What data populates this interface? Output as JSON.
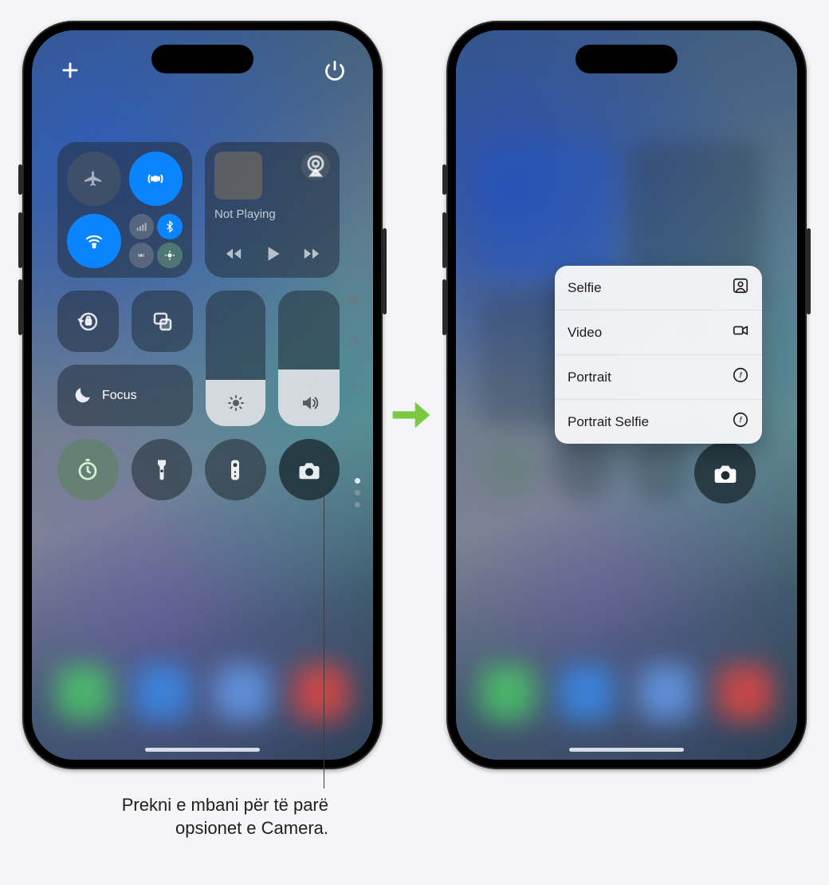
{
  "control_center": {
    "music": {
      "status": "Not Playing"
    },
    "focus": {
      "label": "Focus"
    },
    "sliders": {
      "brightness_pct": 34,
      "volume_pct": 42
    }
  },
  "camera_menu": {
    "items": [
      {
        "label": "Selfie",
        "icon": "person-square-icon"
      },
      {
        "label": "Video",
        "icon": "video-icon"
      },
      {
        "label": "Portrait",
        "icon": "aperture-icon"
      },
      {
        "label": "Portrait Selfie",
        "icon": "aperture-icon"
      }
    ]
  },
  "callout": {
    "line1": "Prekni e mbani për të parë",
    "line2": "opsionet e Camera."
  },
  "icons": {
    "add": "add-icon",
    "power": "power-icon",
    "airplane": "airplane-icon",
    "airdrop": "airdrop-icon",
    "wifi": "wifi-icon",
    "cellular": "cellular-icon",
    "bluetooth": "bluetooth-icon",
    "hotspot": "hotspot-icon",
    "satellite": "satellite-icon",
    "airplay": "airplay-icon",
    "rewind": "rewind-icon",
    "play": "play-icon",
    "forward": "forward-icon",
    "orientation_lock": "orientation-lock-icon",
    "screen_mirroring": "screen-mirroring-icon",
    "dnd": "moon-icon",
    "brightness": "sun-icon",
    "volume": "speaker-icon",
    "favorites_dot": "heart-icon",
    "music_dot": "music-note-icon",
    "broadcast_dot": "broadcast-icon",
    "timer": "timer-icon",
    "flashlight": "flashlight-icon",
    "remote": "remote-icon",
    "camera": "camera-icon"
  }
}
